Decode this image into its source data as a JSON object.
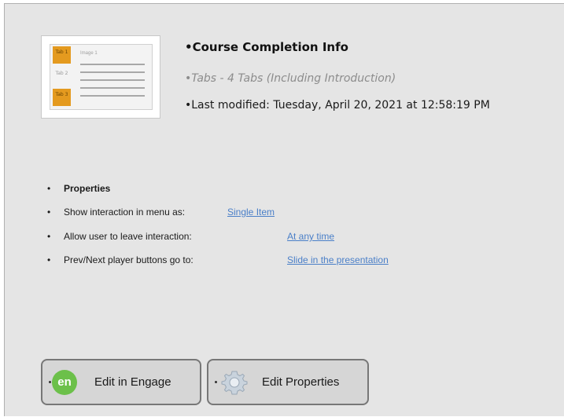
{
  "thumbnail": {
    "tabs": [
      "Tab 1",
      "Tab 2",
      "Tab 3"
    ],
    "image_label": "Image 1"
  },
  "info": {
    "title": "•Course Completion Info",
    "tabs_summary": "•Tabs - 4 Tabs (Including Introduction)",
    "last_modified": "•Last modified: Tuesday, April 20, 2021 at 12:58:19 PM"
  },
  "properties": {
    "heading": "Properties",
    "rows": [
      {
        "label": "Show interaction in menu as:",
        "value": "Single Item"
      },
      {
        "label": "Allow user to leave interaction:",
        "value": "At any time"
      },
      {
        "label": "Prev/Next player buttons go to:",
        "value": "Slide in the presentation"
      }
    ]
  },
  "buttons": {
    "edit_engage": {
      "label": "Edit in Engage",
      "icon_text": "en"
    },
    "edit_properties": {
      "label": "Edit Properties"
    }
  },
  "colors": {
    "panel_background": "#e5e5e5",
    "link": "#4a7fc8",
    "engage_icon": "#6cc04a",
    "tab_orange": "#e49a1f"
  }
}
